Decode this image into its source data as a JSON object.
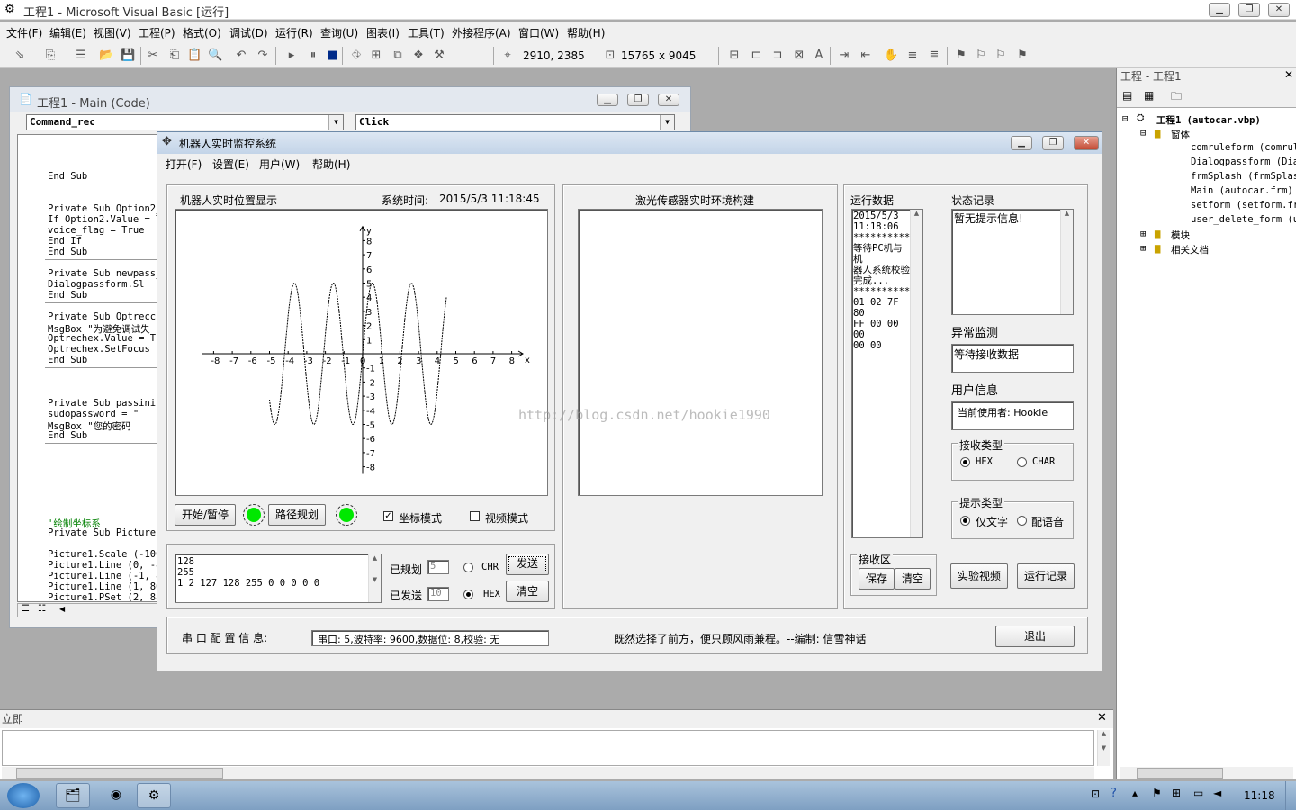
{
  "vb": {
    "title": "工程1 - Microsoft Visual Basic [运行]",
    "menu": [
      "文件(F)",
      "编辑(E)",
      "视图(V)",
      "工程(P)",
      "格式(O)",
      "调试(D)",
      "运行(R)",
      "查询(U)",
      "图表(I)",
      "工具(T)",
      "外接程序(A)",
      "窗口(W)",
      "帮助(H)"
    ],
    "position_readout": "2910, 2385",
    "size_readout": "15765 x 9045"
  },
  "code_window": {
    "title": "工程1 - Main (Code)",
    "object_combo": "Command_rec",
    "proc_combo": "Click",
    "lines": [
      "End Sub",
      "Private Sub Option2_(",
      "If Option2.Value = Tr",
      "    voice_flag = True",
      "End If",
      "End Sub",
      "Private Sub newpass_(",
      "    Dialogpassform.Sl",
      "End Sub",
      "Private Sub Optrecche",
      "MsgBox \"为避免调试失",
      "Optrechex.Value = Tru",
      "Optrechex.SetFocus",
      "End Sub",
      "Private Sub passinit",
      "    sudopassword = \"",
      "    MsgBox \"您的密码",
      "End Sub",
      "'绘制坐标系",
      "Private Sub Picture1",
      "Picture1.Scale (-100,",
      "Picture1.Line (0, -8",
      "Picture1.Line (-1, 8",
      "Picture1.Line (1, 86",
      "Picture1.PSet (2, 88"
    ]
  },
  "robot": {
    "title": "机器人实时监控系统",
    "menu": [
      "打开(F)",
      "设置(E)",
      "用户(W)",
      "帮助(H)"
    ],
    "position_panel_label": "机器人实时位置显示",
    "system_time_label": "系统时间:",
    "system_time_value": "2015/5/3 11:18:45",
    "laser_panel_label": "激光传感器实时环境构建",
    "start_pause_label": "开始/暂停",
    "path_plan_label": "路径规划",
    "coord_mode_label": "坐标模式",
    "video_mode_label": "视频模式",
    "send_box": [
      "128",
      "255",
      "1 2 127 128 255 0 0 0 0 0"
    ],
    "planned_label": "已规划",
    "planned_value": "5",
    "sent_label": "已发送",
    "sent_value": "10",
    "chr_label": "CHR",
    "hex_label": "HEX",
    "send_button": "发送",
    "clear_button": "清空",
    "run_data_label": "运行数据",
    "run_data_text": [
      "2015/5/3",
      "11:18:06",
      "************",
      "等待PC机与机",
      "器人系统校验",
      "完成...",
      "************",
      "01 02 7F 80",
      "FF 00 00 00",
      "00 00"
    ],
    "receive_area_label": "接收区",
    "save_button": "保存",
    "receive_clear_button": "清空",
    "status_log_label": "状态记录",
    "status_log_text": "暂无提示信息!",
    "anomaly_label": "异常监测",
    "anomaly_text": "等待接收数据",
    "user_info_label": "用户信息",
    "user_info_text": "当前使用者: Hookie",
    "recv_type_label": "接收类型",
    "recv_hex": "HEX",
    "recv_char": "CHAR",
    "hint_type_label": "提示类型",
    "hint_text_only": "仅文字",
    "hint_voice": "配语音",
    "experiment_video_button": "实验视频",
    "run_log_button": "运行记录",
    "serial_label": "串 口 配 置 信 息:",
    "serial_value": "串口: 5,波特率: 9600,数据位: 8,校验: 无",
    "motto": "既然选择了前方，便只顾风雨兼程。--编制: 信雪神话",
    "exit_button": "退出"
  },
  "chart_data": {
    "type": "line",
    "title": "",
    "xlabel": "x",
    "ylabel": "y",
    "xlim": [
      -9,
      9
    ],
    "ylim": [
      -8.5,
      9
    ],
    "x_ticks": [
      -8,
      -7,
      -6,
      -5,
      -4,
      -3,
      -2,
      -1,
      0,
      1,
      2,
      3,
      4,
      5,
      6,
      7,
      8
    ],
    "y_ticks": [
      -8,
      -7,
      -6,
      -5,
      -4,
      -3,
      -2,
      -1,
      1,
      2,
      3,
      4,
      5,
      6,
      7,
      8
    ],
    "series": [
      {
        "function": "5*sin(3*x)",
        "x_range": [
          -5,
          4.5
        ]
      }
    ]
  },
  "project": {
    "title": "工程 - 工程1",
    "root": "工程1 (autocar.vbp)",
    "forms_folder": "窗体",
    "forms": [
      "comruleform (comrul",
      "Dialogpassform (Dia",
      "frmSplash (frmSplas",
      "Main (autocar.frm)",
      "setform (setform.fr",
      "user_delete_form (u"
    ],
    "modules_folder": "模块",
    "docs_folder": "相关文档"
  },
  "immediate": {
    "title": "立即"
  },
  "taskbar": {
    "clock": "11:18"
  },
  "watermark": "http://blog.csdn.net/hookie1990"
}
